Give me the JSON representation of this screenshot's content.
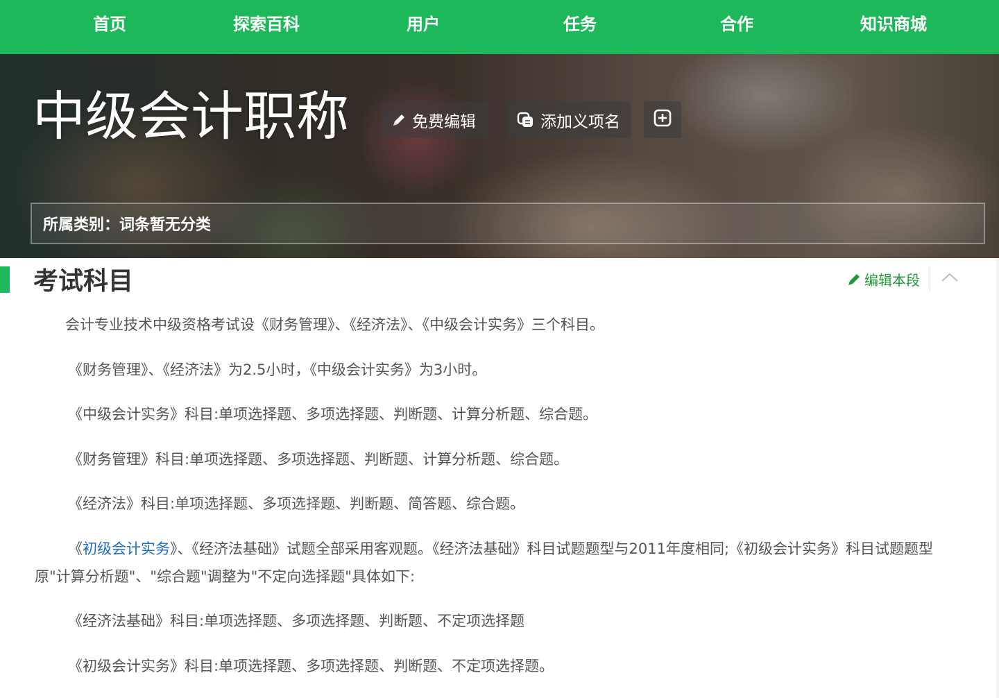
{
  "nav": {
    "items": [
      "首页",
      "探索百科",
      "用户",
      "任务",
      "合作",
      "知识商城"
    ]
  },
  "hero": {
    "title": "中级会计职称",
    "edit_label": "免费编辑",
    "add_meaning_label": "添加义项名",
    "category": "所属类别：词条暂无分类"
  },
  "section": {
    "title": "考试科目",
    "edit_label": "编辑本段"
  },
  "content": {
    "p1": "会计专业技术中级资格考试设《财务管理》、《经济法》、《中级会计实务》三个科目。",
    "p2": "《财务管理》、《经济法》为2.5小时，《中级会计实务》为3小时。",
    "p3": "《中级会计实务》科目:单项选择题、多项选择题、判断题、计算分析题、综合题。",
    "p4": "《财务管理》科目:单项选择题、多项选择题、判断题、计算分析题、综合题。",
    "p5": "《经济法》科目:单项选择题、多项选择题、判断题、简答题、综合题。",
    "p6_open": "《",
    "p6_link": "初级会计实务",
    "p6_rest": "》、《经济法基础》试题全部采用客观题。《经济法基础》科目试题题型与2011年度相同;《初级会计实务》科目试题题型原\"计算分析题\"、\"综合题\"调整为\"不定向选择题\"具体如下:",
    "p7": "《经济法基础》科目:单项选择题、多项选择题、判断题、不定项选择题",
    "p8": "《初级会计实务》科目:单项选择题、多项选择题、判断题、不定项选择题。"
  },
  "colors": {
    "brand_green": "#1cb85a",
    "link_blue": "#1e6fc0",
    "edit_green": "#1f9a3a"
  }
}
